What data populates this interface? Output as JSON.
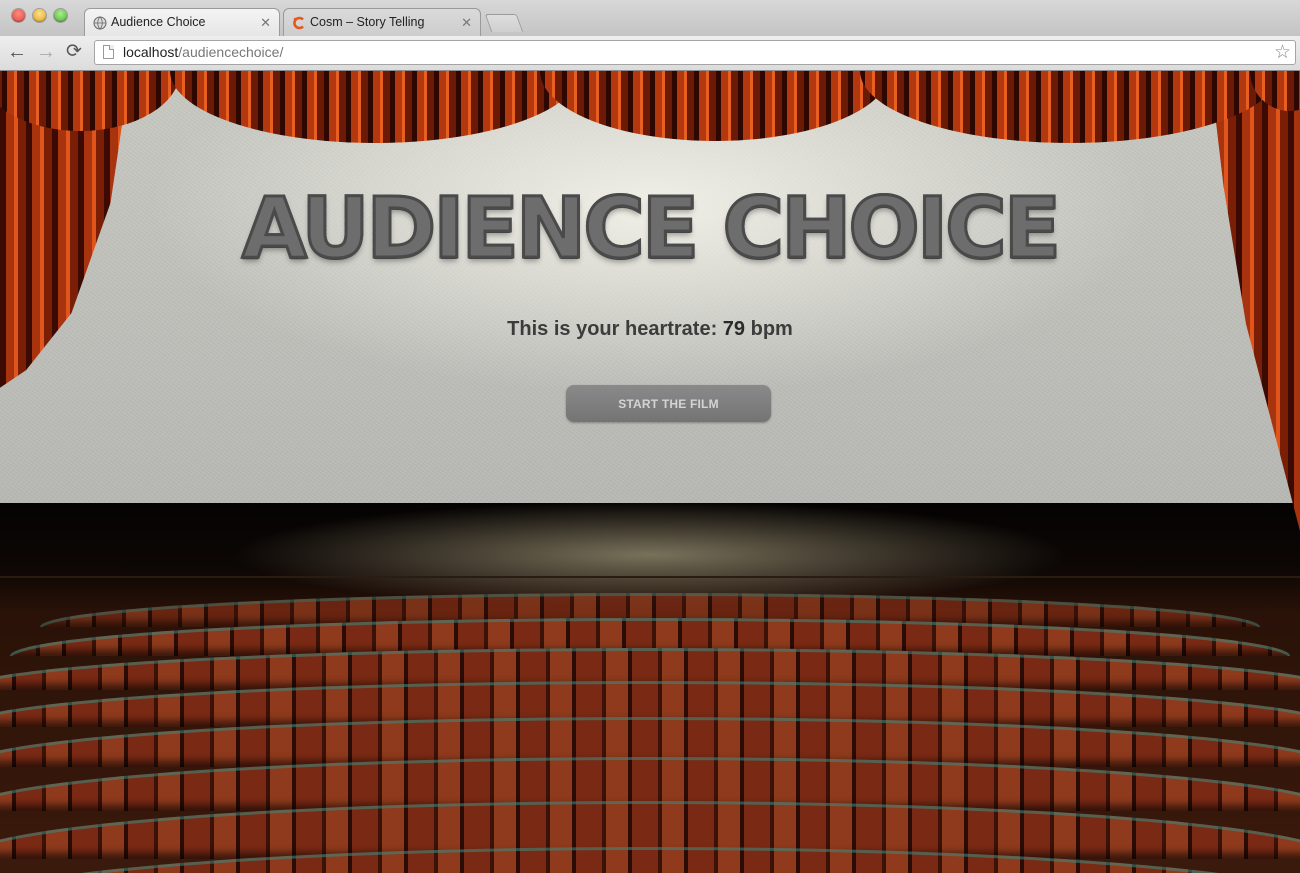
{
  "browser": {
    "tabs": [
      {
        "title": "Audience Choice",
        "active": true,
        "icon": "globe-icon"
      },
      {
        "title": "Cosm – Story Telling",
        "active": false,
        "icon": "cosm-logo-icon"
      }
    ],
    "url_host": "localhost",
    "url_path": "/audiencechoice/",
    "icons": [
      "back-icon",
      "forward-icon",
      "reload-icon",
      "bookmark-star-icon"
    ]
  },
  "page": {
    "title": "AUDIENCE CHOICE",
    "heartrate_prefix": "This is your heartrate:",
    "heartrate_value": "79",
    "heartrate_unit": "bpm",
    "start_button_label": "START THE FILM"
  },
  "colors": {
    "curtain": "#c2431a",
    "seat": "#7a2a14",
    "screen": "#c4c4bf",
    "button": "#7d7d7d"
  }
}
